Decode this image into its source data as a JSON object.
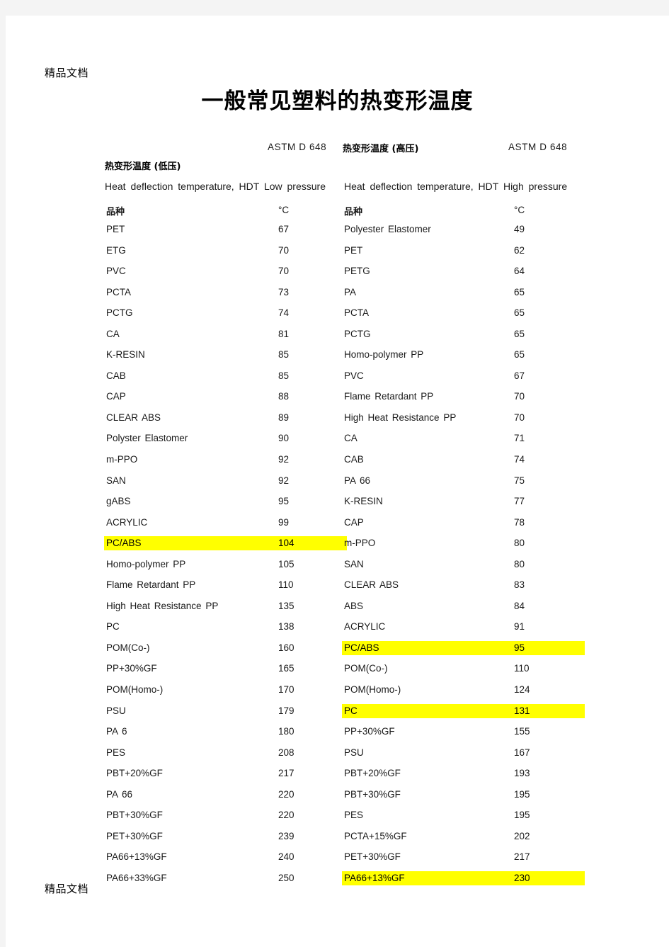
{
  "watermark": {
    "top": "精品文档",
    "bottom": "精品文档"
  },
  "title": "一般常见塑料的热变形温度",
  "header": {
    "astm_left": "ASTM D 648",
    "cn_high": "热变形温度 (高压)",
    "astm_right": "ASTM D 648",
    "cn_low": "热变形温度 (低压)",
    "en_left": "Heat deflection temperature, HDT Low pressure",
    "en_right": "Heat deflection temperature, HDT High pressure"
  },
  "columns": {
    "left": {
      "name_header": "品种",
      "value_header": "°C"
    },
    "right": {
      "name_header": "品种",
      "value_header": "°C"
    }
  },
  "highlight_color": "#ffff00",
  "chart_data": {
    "type": "table",
    "title": "一般常见塑料的热变形温度",
    "tables": [
      {
        "name": "Heat deflection temperature, HDT Low pressure",
        "standard": "ASTM D 648",
        "chinese_label": "热变形温度 (低压)",
        "headers": [
          "品种",
          "°C"
        ],
        "unit": "°C"
      },
      {
        "name": "Heat deflection temperature, HDT High pressure",
        "standard": "ASTM D 648",
        "chinese_label": "热变形温度 (高压)",
        "headers": [
          "品种",
          "°C"
        ],
        "unit": "°C"
      }
    ]
  },
  "left_rows": [
    {
      "name": "PET",
      "value": "67",
      "highlight": false
    },
    {
      "name": "ETG",
      "value": "70",
      "highlight": false
    },
    {
      "name": "PVC",
      "value": "70",
      "highlight": false
    },
    {
      "name": "PCTA",
      "value": "73",
      "highlight": false
    },
    {
      "name": "PCTG",
      "value": "74",
      "highlight": false
    },
    {
      "name": "CA",
      "value": "81",
      "highlight": false
    },
    {
      "name": "K-RESIN",
      "value": "85",
      "highlight": false
    },
    {
      "name": "CAB",
      "value": "85",
      "highlight": false
    },
    {
      "name": "CAP",
      "value": "88",
      "highlight": false
    },
    {
      "name": "CLEAR ABS",
      "value": "89",
      "highlight": false
    },
    {
      "name": "Polyster Elastomer",
      "value": "90",
      "highlight": false
    },
    {
      "name": "m-PPO",
      "value": "92",
      "highlight": false
    },
    {
      "name": "SAN",
      "value": "92",
      "highlight": false
    },
    {
      "name": "gABS",
      "value": "95",
      "highlight": false
    },
    {
      "name": "ACRYLIC",
      "value": "99",
      "highlight": false
    },
    {
      "name": "PC/ABS",
      "value": "104",
      "highlight": true
    },
    {
      "name": "Homo-polymer PP",
      "value": "105",
      "highlight": false
    },
    {
      "name": "Flame Retardant PP",
      "value": "110",
      "highlight": false
    },
    {
      "name": "High Heat Resistance PP",
      "value": "135",
      "highlight": false
    },
    {
      "name": "PC",
      "value": "138",
      "highlight": false
    },
    {
      "name": "POM(Co-)",
      "value": "160",
      "highlight": false
    },
    {
      "name": "PP+30%GF",
      "value": "165",
      "highlight": false
    },
    {
      "name": "POM(Homo-)",
      "value": "170",
      "highlight": false
    },
    {
      "name": "PSU",
      "value": "179",
      "highlight": false
    },
    {
      "name": "PA 6",
      "value": "180",
      "highlight": false
    },
    {
      "name": "PES",
      "value": "208",
      "highlight": false
    },
    {
      "name": "PBT+20%GF",
      "value": "217",
      "highlight": false
    },
    {
      "name": "PA 66",
      "value": "220",
      "highlight": false
    },
    {
      "name": "PBT+30%GF",
      "value": "220",
      "highlight": false
    },
    {
      "name": "PET+30%GF",
      "value": "239",
      "highlight": false
    },
    {
      "name": "PA66+13%GF",
      "value": "240",
      "highlight": false
    },
    {
      "name": "PA66+33%GF",
      "value": "250",
      "highlight": false
    }
  ],
  "right_rows": [
    {
      "name": "Polyester Elastomer",
      "value": "49",
      "highlight": false
    },
    {
      "name": "PET",
      "value": "62",
      "highlight": false
    },
    {
      "name": "PETG",
      "value": "64",
      "highlight": false
    },
    {
      "name": "PA",
      "value": "65",
      "highlight": false
    },
    {
      "name": "PCTA",
      "value": "65",
      "highlight": false
    },
    {
      "name": "PCTG",
      "value": "65",
      "highlight": false
    },
    {
      "name": "Homo-polymer PP",
      "value": "65",
      "highlight": false
    },
    {
      "name": "PVC",
      "value": "67",
      "highlight": false
    },
    {
      "name": "Flame Retardant PP",
      "value": "70",
      "highlight": false
    },
    {
      "name": "High Heat Resistance PP",
      "value": "70",
      "highlight": false
    },
    {
      "name": "CA",
      "value": "71",
      "highlight": false
    },
    {
      "name": "CAB",
      "value": "74",
      "highlight": false
    },
    {
      "name": "PA 66",
      "value": "75",
      "highlight": false
    },
    {
      "name": "K-RESIN",
      "value": "77",
      "highlight": false
    },
    {
      "name": "CAP",
      "value": "78",
      "highlight": false
    },
    {
      "name": "m-PPO",
      "value": "80",
      "highlight": false
    },
    {
      "name": "SAN",
      "value": "80",
      "highlight": false
    },
    {
      "name": "CLEAR ABS",
      "value": "83",
      "highlight": false
    },
    {
      "name": "ABS",
      "value": "84",
      "highlight": false
    },
    {
      "name": "ACRYLIC",
      "value": "91",
      "highlight": false
    },
    {
      "name": "PC/ABS",
      "value": "95",
      "highlight": true
    },
    {
      "name": "POM(Co-)",
      "value": "110",
      "highlight": false
    },
    {
      "name": "POM(Homo-)",
      "value": "124",
      "highlight": false
    },
    {
      "name": "PC",
      "value": "131",
      "highlight": true
    },
    {
      "name": "PP+30%GF",
      "value": "155",
      "highlight": false
    },
    {
      "name": "PSU",
      "value": "167",
      "highlight": false
    },
    {
      "name": "PBT+20%GF",
      "value": "193",
      "highlight": false
    },
    {
      "name": "PBT+30%GF",
      "value": "195",
      "highlight": false
    },
    {
      "name": "PES",
      "value": "195",
      "highlight": false
    },
    {
      "name": "PCTA+15%GF",
      "value": "202",
      "highlight": false
    },
    {
      "name": "PET+30%GF",
      "value": "217",
      "highlight": false
    },
    {
      "name": "PA66+13%GF",
      "value": "230",
      "highlight": true
    }
  ]
}
